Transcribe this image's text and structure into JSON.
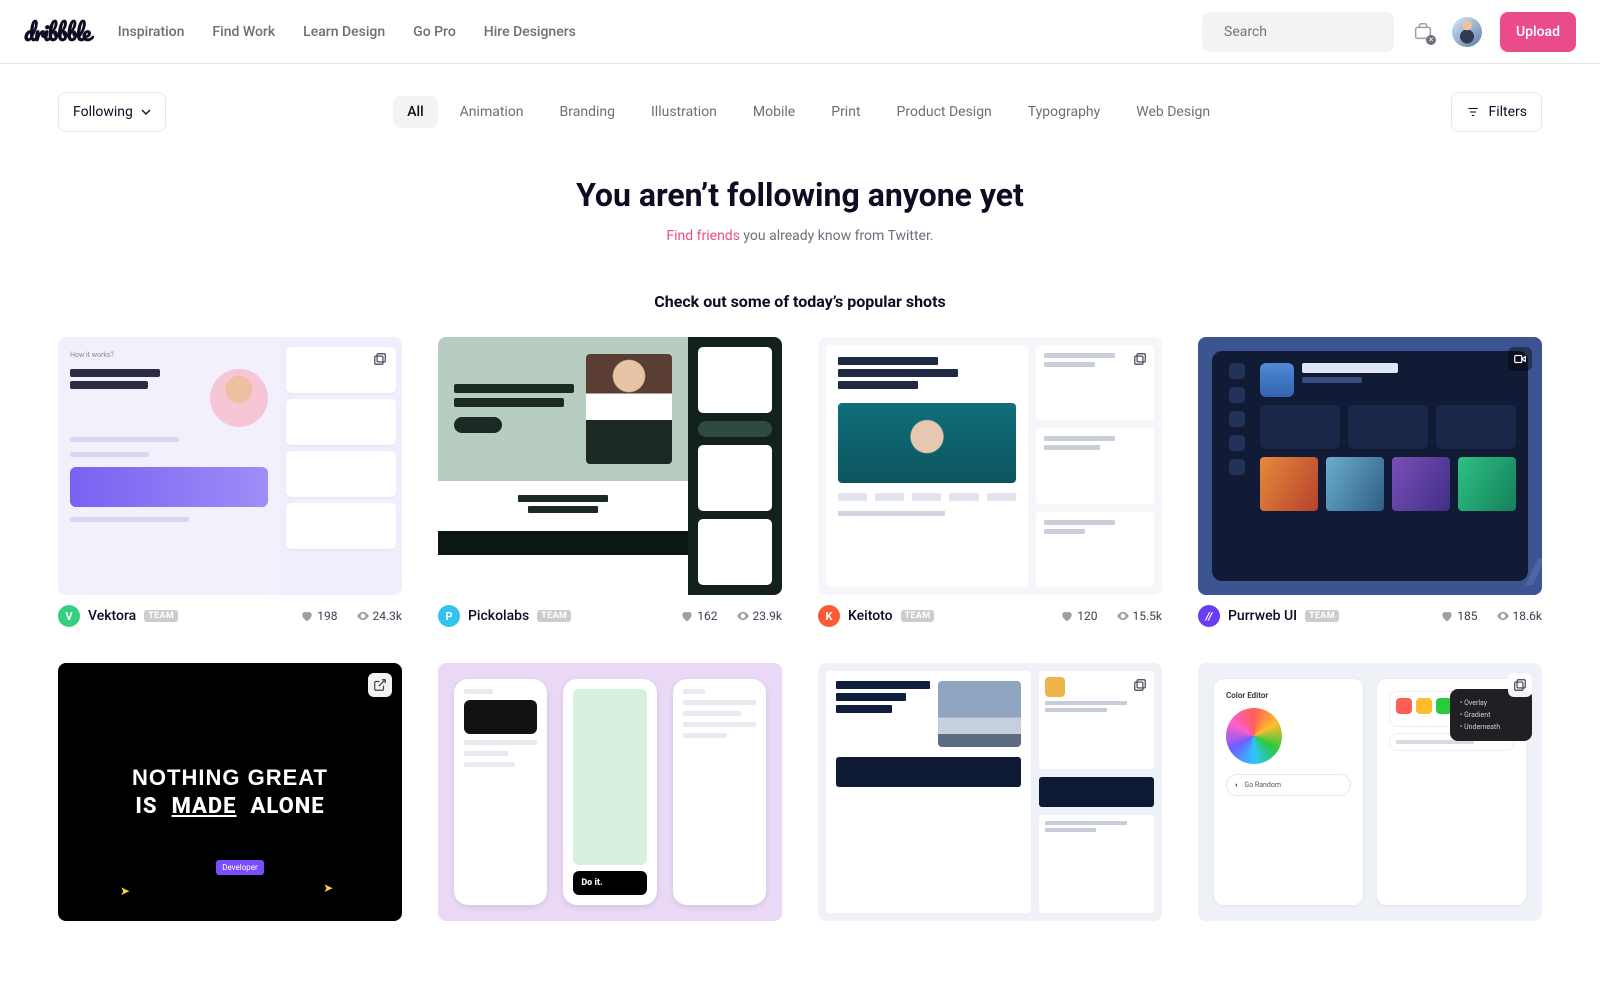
{
  "nav": {
    "logo": "dribbble",
    "links": [
      "Inspiration",
      "Find Work",
      "Learn Design",
      "Go Pro",
      "Hire Designers"
    ],
    "search_placeholder": "Search",
    "upload": "Upload"
  },
  "filter": {
    "dropdown": "Following",
    "tabs": [
      "All",
      "Animation",
      "Branding",
      "Illustration",
      "Mobile",
      "Print",
      "Product Design",
      "Typography",
      "Web Design"
    ],
    "active_tab": 0,
    "filters": "Filters"
  },
  "empty": {
    "title": "You aren’t following anyone yet",
    "link": "Find friends",
    "rest": " you already know from Twitter.",
    "popular": "Check out some of today’s popular shots"
  },
  "shots": [
    {
      "author": "Vektora",
      "team": "TEAM",
      "likes": "198",
      "views": "24.3k",
      "avatar_bg": "#35d07f",
      "avatar_txt": "V",
      "badge": "stack"
    },
    {
      "author": "Pickolabs",
      "team": "TEAM",
      "likes": "162",
      "views": "23.9k",
      "avatar_bg": "#33c3f0",
      "avatar_txt": "P",
      "badge": null
    },
    {
      "author": "Keitoto",
      "team": "TEAM",
      "likes": "120",
      "views": "15.5k",
      "avatar_bg": "#ff5a36",
      "avatar_txt": "K",
      "badge": "stack"
    },
    {
      "author": "Purrweb UI",
      "team": "TEAM",
      "likes": "185",
      "views": "18.6k",
      "avatar_bg": "#6a3df5",
      "avatar_txt": "//",
      "badge": "video"
    },
    {
      "author": "",
      "team": "",
      "likes": "",
      "views": "",
      "avatar_bg": "",
      "avatar_txt": "",
      "badge": "external"
    },
    {
      "author": "",
      "team": "",
      "likes": "",
      "views": "",
      "avatar_bg": "",
      "avatar_txt": "",
      "badge": null
    },
    {
      "author": "",
      "team": "",
      "likes": "",
      "views": "",
      "avatar_bg": "",
      "avatar_txt": "",
      "badge": "stack"
    },
    {
      "author": "",
      "team": "",
      "likes": "",
      "views": "",
      "avatar_bg": "",
      "avatar_txt": "",
      "badge": "stack"
    }
  ],
  "thumb_text": {
    "t5_line1": "NOTHING GREAT",
    "t5_is": "IS",
    "t5_made": "MADE",
    "t5_alone": "ALONE",
    "t5_tag": "Developer",
    "t6_doit": "Do it.",
    "t8_title": "Color Editor"
  }
}
